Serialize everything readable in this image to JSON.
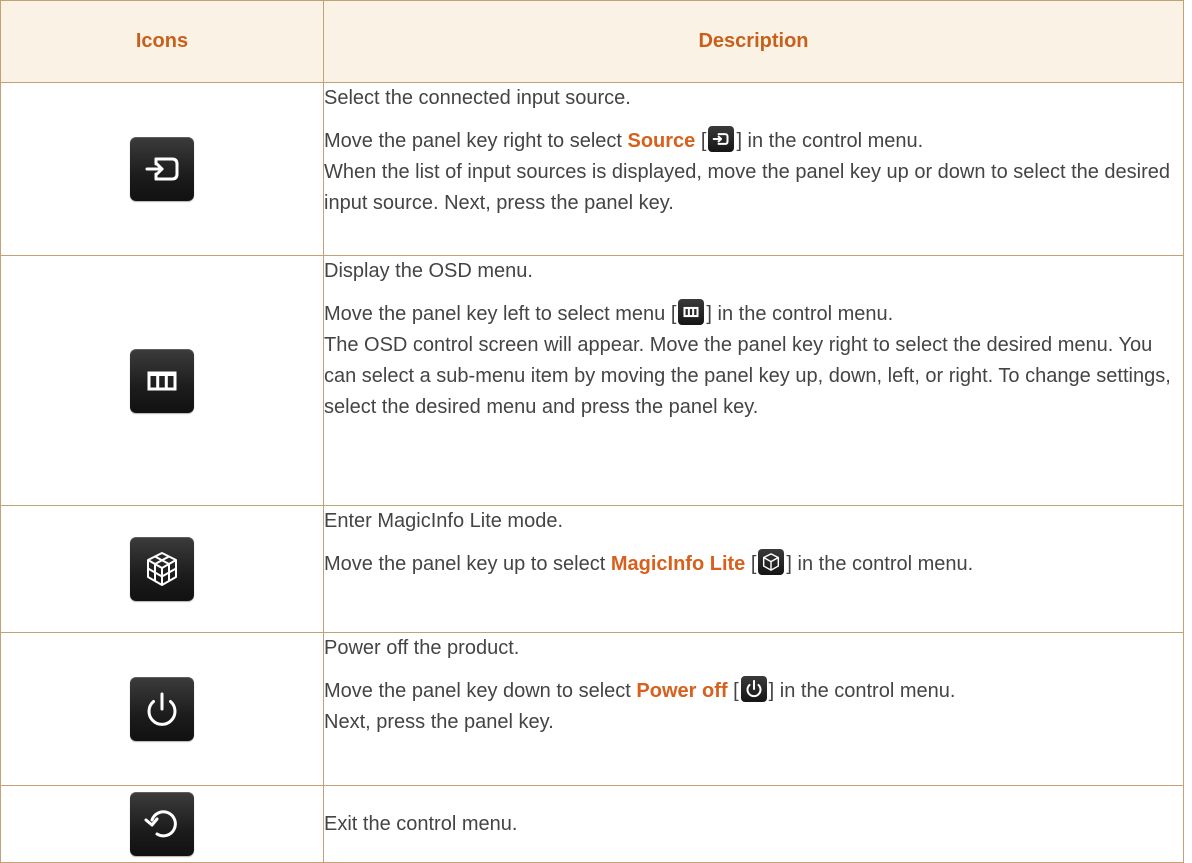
{
  "table": {
    "headers": {
      "icons": "Icons",
      "description": "Description"
    },
    "rows": [
      {
        "icon": "source-icon",
        "summary": "Select the connected input source.",
        "detail_pre": "Move the panel key right to select ",
        "highlight": "Source",
        "bracket_open": " [",
        "bracket_close": "] in the control menu.",
        "detail_post": "When the list of input sources is displayed, move the panel key up or down to select the desired input source. Next, press the panel key."
      },
      {
        "icon": "menu-icon",
        "summary": "Display the OSD menu.",
        "detail_pre": "Move the panel key left to select menu [",
        "bracket_close": "] in the control menu.",
        "detail_post": "The OSD control screen will appear. Move the panel key right to select the desired menu. You can select a sub-menu item by moving the panel key up, down, left, or right. To change settings, select the desired menu and press the panel key."
      },
      {
        "icon": "magicinfo-icon",
        "summary": "Enter MagicInfo Lite mode.",
        "detail_pre": "Move the panel key up to select ",
        "highlight": "MagicInfo Lite",
        "bracket_open": " [",
        "bracket_close": "] in the control menu."
      },
      {
        "icon": "power-icon",
        "summary": "Power off the product.",
        "detail_pre": "Move the panel key down to select ",
        "highlight": "Power off",
        "bracket_open": " [",
        "bracket_close": "] in the control menu.",
        "detail_post": "Next, press the panel key."
      },
      {
        "icon": "return-icon",
        "summary": "Exit the control menu."
      }
    ]
  },
  "colors": {
    "header_text": "#c8601c",
    "header_bg": "#fbf2e6",
    "border": "#c4a078",
    "highlight": "#d8601c",
    "body_text": "#444444"
  }
}
